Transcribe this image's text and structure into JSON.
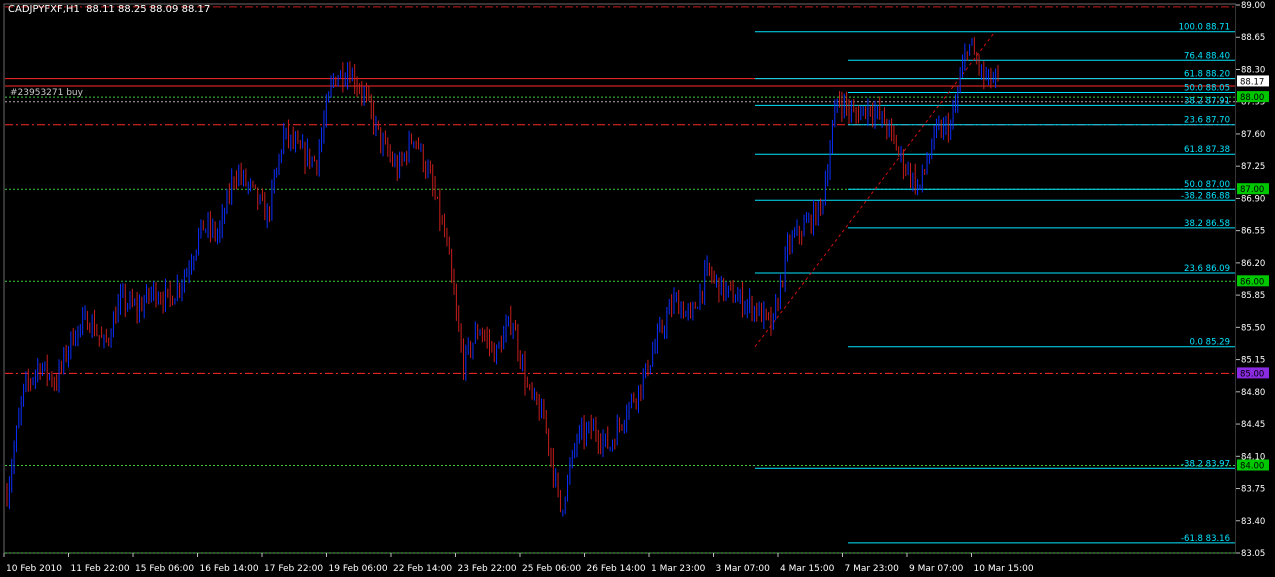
{
  "header": {
    "title": "CADJPYFXF,H1  88.11 88.25 88.09 88.17"
  },
  "order": {
    "label": "#23953271 buy"
  },
  "colors": {
    "background": "#000000",
    "bull": "#0b2fff",
    "bear": "#c81e1e",
    "fib": "#00e5ff",
    "grid_green": "#3ec83e",
    "resistance": "#ff2a2a",
    "current_price_bg": "#ffffff",
    "pivot_purple": "#8a2be2"
  },
  "chart_data": {
    "type": "candlestick",
    "symbol": "CADJPYFXF",
    "timeframe": "H1",
    "ylim": [
      83.05,
      89.0
    ],
    "y_ticks": [
      "89.00",
      "88.65",
      "88.30",
      "87.95",
      "87.60",
      "87.25",
      "86.90",
      "86.55",
      "86.20",
      "85.85",
      "85.50",
      "85.15",
      "84.80",
      "84.45",
      "84.10",
      "83.75",
      "83.40",
      "83.05"
    ],
    "x_ticks": [
      "10 Feb 2010",
      "11 Feb 22:00",
      "15 Feb 06:00",
      "16 Feb 14:00",
      "17 Feb 22:00",
      "19 Feb 06:00",
      "22 Feb 14:00",
      "23 Feb 22:00",
      "25 Feb 06:00",
      "26 Feb 14:00",
      "1 Mar 23:00",
      "3 Mar 07:00",
      "4 Mar 15:00",
      "7 Mar 23:00",
      "9 Mar 07:00",
      "10 Mar 15:00"
    ],
    "price_path": [
      83.7,
      84.8,
      85.1,
      84.9,
      85.4,
      85.6,
      85.3,
      85.8,
      85.7,
      85.9,
      85.8,
      86.1,
      86.6,
      86.5,
      87.2,
      87.0,
      86.7,
      87.6,
      87.4,
      87.3,
      88.2,
      88.3,
      88.0,
      87.5,
      87.2,
      87.6,
      87.1,
      86.4,
      85.1,
      85.5,
      85.2,
      85.6,
      84.8,
      84.5,
      83.5,
      84.3,
      84.4,
      84.2,
      84.6,
      84.9,
      85.4,
      85.8,
      85.6,
      86.1,
      85.9,
      85.8,
      85.7,
      85.5,
      86.4,
      86.6,
      86.8,
      88.0,
      87.8,
      87.9,
      87.7,
      87.3,
      87.0,
      87.6,
      87.7,
      88.6,
      88.2,
      88.17
    ],
    "current_price": "88.17",
    "highlighted_price_labels": [
      {
        "price": 88.0,
        "text": "88.00",
        "bg": "#00c800"
      },
      {
        "price": 87.0,
        "text": "87.00",
        "bg": "#00c800"
      },
      {
        "price": 86.0,
        "text": "86.00",
        "bg": "#00c800"
      },
      {
        "price": 85.0,
        "text": "85.00",
        "bg": "#8a2be2"
      },
      {
        "price": 84.0,
        "text": "84.00",
        "bg": "#00c800"
      }
    ],
    "horizontal_lines": [
      {
        "price": 88.98,
        "style": "dash-dot",
        "color": "#c81e1e"
      },
      {
        "price": 88.2,
        "style": "solid",
        "color": "#ff2a2a"
      },
      {
        "price": 88.12,
        "style": "solid",
        "color": "#ff2a2a"
      },
      {
        "price": 88.0,
        "style": "dotted",
        "color": "#3ec83e"
      },
      {
        "price": 87.95,
        "style": "dotted",
        "color": "#aaaaaa"
      },
      {
        "price": 87.7,
        "style": "dash-dot",
        "color": "#ff2a2a"
      },
      {
        "price": 87.0,
        "style": "dotted",
        "color": "#3ec83e"
      },
      {
        "price": 86.0,
        "style": "dotted",
        "color": "#3ec83e"
      },
      {
        "price": 85.0,
        "style": "dash-dot",
        "color": "#ff2a2a"
      },
      {
        "price": 84.0,
        "style": "dotted",
        "color": "#3ec83e"
      },
      {
        "price": 83.05,
        "style": "dotted",
        "color": "#3ec83e"
      }
    ],
    "fib_levels": [
      {
        "label": "100.0  88.71",
        "price": 88.71
      },
      {
        "label": "76.4  88.40",
        "price": 88.4
      },
      {
        "label": "61.8  88.20",
        "price": 88.2
      },
      {
        "label": "50.0  88.05",
        "price": 88.05
      },
      {
        "label": "38.2  87.91",
        "price": 87.91
      },
      {
        "label": "23.6  87.70",
        "price": 87.7
      },
      {
        "label": "61.8  87.38",
        "price": 87.38
      },
      {
        "label": "50.0  87.00",
        "price": 87.0
      },
      {
        "label": "-38.2  86.88",
        "price": 86.88
      },
      {
        "label": "38.2  86.58",
        "price": 86.58
      },
      {
        "label": "23.6  86.09",
        "price": 86.09
      },
      {
        "label": "0.0  85.29",
        "price": 85.29
      },
      {
        "label": "-38.2  83.97",
        "price": 83.97
      },
      {
        "label": "-61.8  83.16",
        "price": 83.16
      }
    ]
  }
}
